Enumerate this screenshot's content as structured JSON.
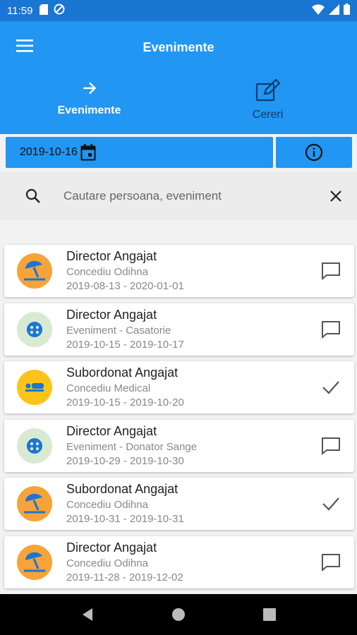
{
  "status_bar": {
    "time": "11:59"
  },
  "app_bar": {
    "title": "Evenimente"
  },
  "tabs": [
    {
      "label": "Evenimente",
      "icon": "arrow-right-icon"
    },
    {
      "label": "Cereri",
      "icon": "edit-icon"
    }
  ],
  "date_picker": {
    "value": "2019-10-16"
  },
  "search": {
    "placeholder": "Cautare persoana, eveniment"
  },
  "events": [
    {
      "name": "Director Angajat",
      "type": "Concediu Odihna",
      "dates": "2019-08-13 - 2020-01-01",
      "icon": "beach-umbrella-icon",
      "action": "comment-icon"
    },
    {
      "name": "Director Angajat",
      "type": "Eveniment - Casatorie",
      "dates": "2019-10-15 - 2019-10-17",
      "icon": "event-icon",
      "action": "comment-icon"
    },
    {
      "name": "Subordonat Angajat",
      "type": "Concediu Medical",
      "dates": "2019-10-15 - 2019-10-20",
      "icon": "medical-bed-icon",
      "action": "check-icon"
    },
    {
      "name": "Director Angajat",
      "type": "Eveniment - Donator Sange",
      "dates": "2019-10-29 - 2019-10-30",
      "icon": "event-icon",
      "action": "comment-icon"
    },
    {
      "name": "Subordonat Angajat",
      "type": "Concediu Odihna",
      "dates": "2019-10-31 - 2019-10-31",
      "icon": "beach-umbrella-icon",
      "action": "check-icon"
    },
    {
      "name": "Director Angajat",
      "type": "Concediu Odihna",
      "dates": "2019-11-28 - 2019-12-02",
      "icon": "beach-umbrella-icon",
      "action": "comment-icon"
    }
  ],
  "colors": {
    "primary": "#2196f3",
    "primary_dark": "#1976d2",
    "vacation": "#f6a33a",
    "event": "#d9ead3",
    "medical": "#fcc419"
  }
}
